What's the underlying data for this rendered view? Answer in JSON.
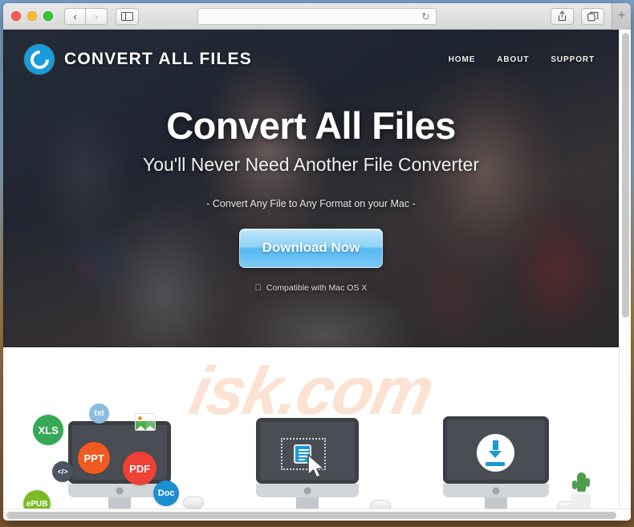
{
  "browser": {
    "window_controls": [
      "close",
      "minimize",
      "maximize"
    ],
    "back_label": "‹",
    "forward_label": "›",
    "sidebar_icon": "sidebar-icon",
    "address_value": "",
    "address_placeholder": "",
    "reload_label": "↻",
    "share_icon": "share-icon",
    "tabs_icon": "tabs-overview-icon",
    "new_tab_label": "+"
  },
  "site": {
    "logo_text": "CONVERT ALL FILES",
    "nav": [
      {
        "label": "HOME"
      },
      {
        "label": "ABOUT"
      },
      {
        "label": "SUPPORT"
      }
    ],
    "hero": {
      "title": "Convert All Files",
      "subtitle": "You'll Never Need Another File Converter",
      "tagline": "- Convert Any File to Any Format on your Mac -",
      "cta_label": "Download Now",
      "compat_icon": "apple-logo-icon",
      "compat_text": "Compatible with Mac OS X"
    },
    "watermark": "isk.com",
    "features": [
      {
        "name": "file-formats",
        "badges": [
          {
            "label": "XLS",
            "color": "#35a957"
          },
          {
            "label": "txt",
            "color": "#8cbce0"
          },
          {
            "label": "PPT",
            "color": "#f15a22"
          },
          {
            "label": "PDF",
            "color": "#ef4136"
          },
          {
            "label": "Doc",
            "color": "#1c8fd0"
          },
          {
            "label": "ePUB",
            "color": "#7dbb26"
          },
          {
            "label": "</>",
            "color": "#4a5560"
          }
        ],
        "image_icon": "photo-icon"
      },
      {
        "name": "drag-and-drop",
        "icons": [
          "dropzone-icon",
          "document-icon",
          "cursor-icon"
        ]
      },
      {
        "name": "download",
        "icons": [
          "download-arrow-icon",
          "cactus-plant-icon"
        ]
      }
    ]
  },
  "colors": {
    "brand_blue": "#1b9bd8",
    "cta_blue": "#54b7ef",
    "watermark": "#fbe2d2",
    "screen_dark": "#4a4d53"
  }
}
